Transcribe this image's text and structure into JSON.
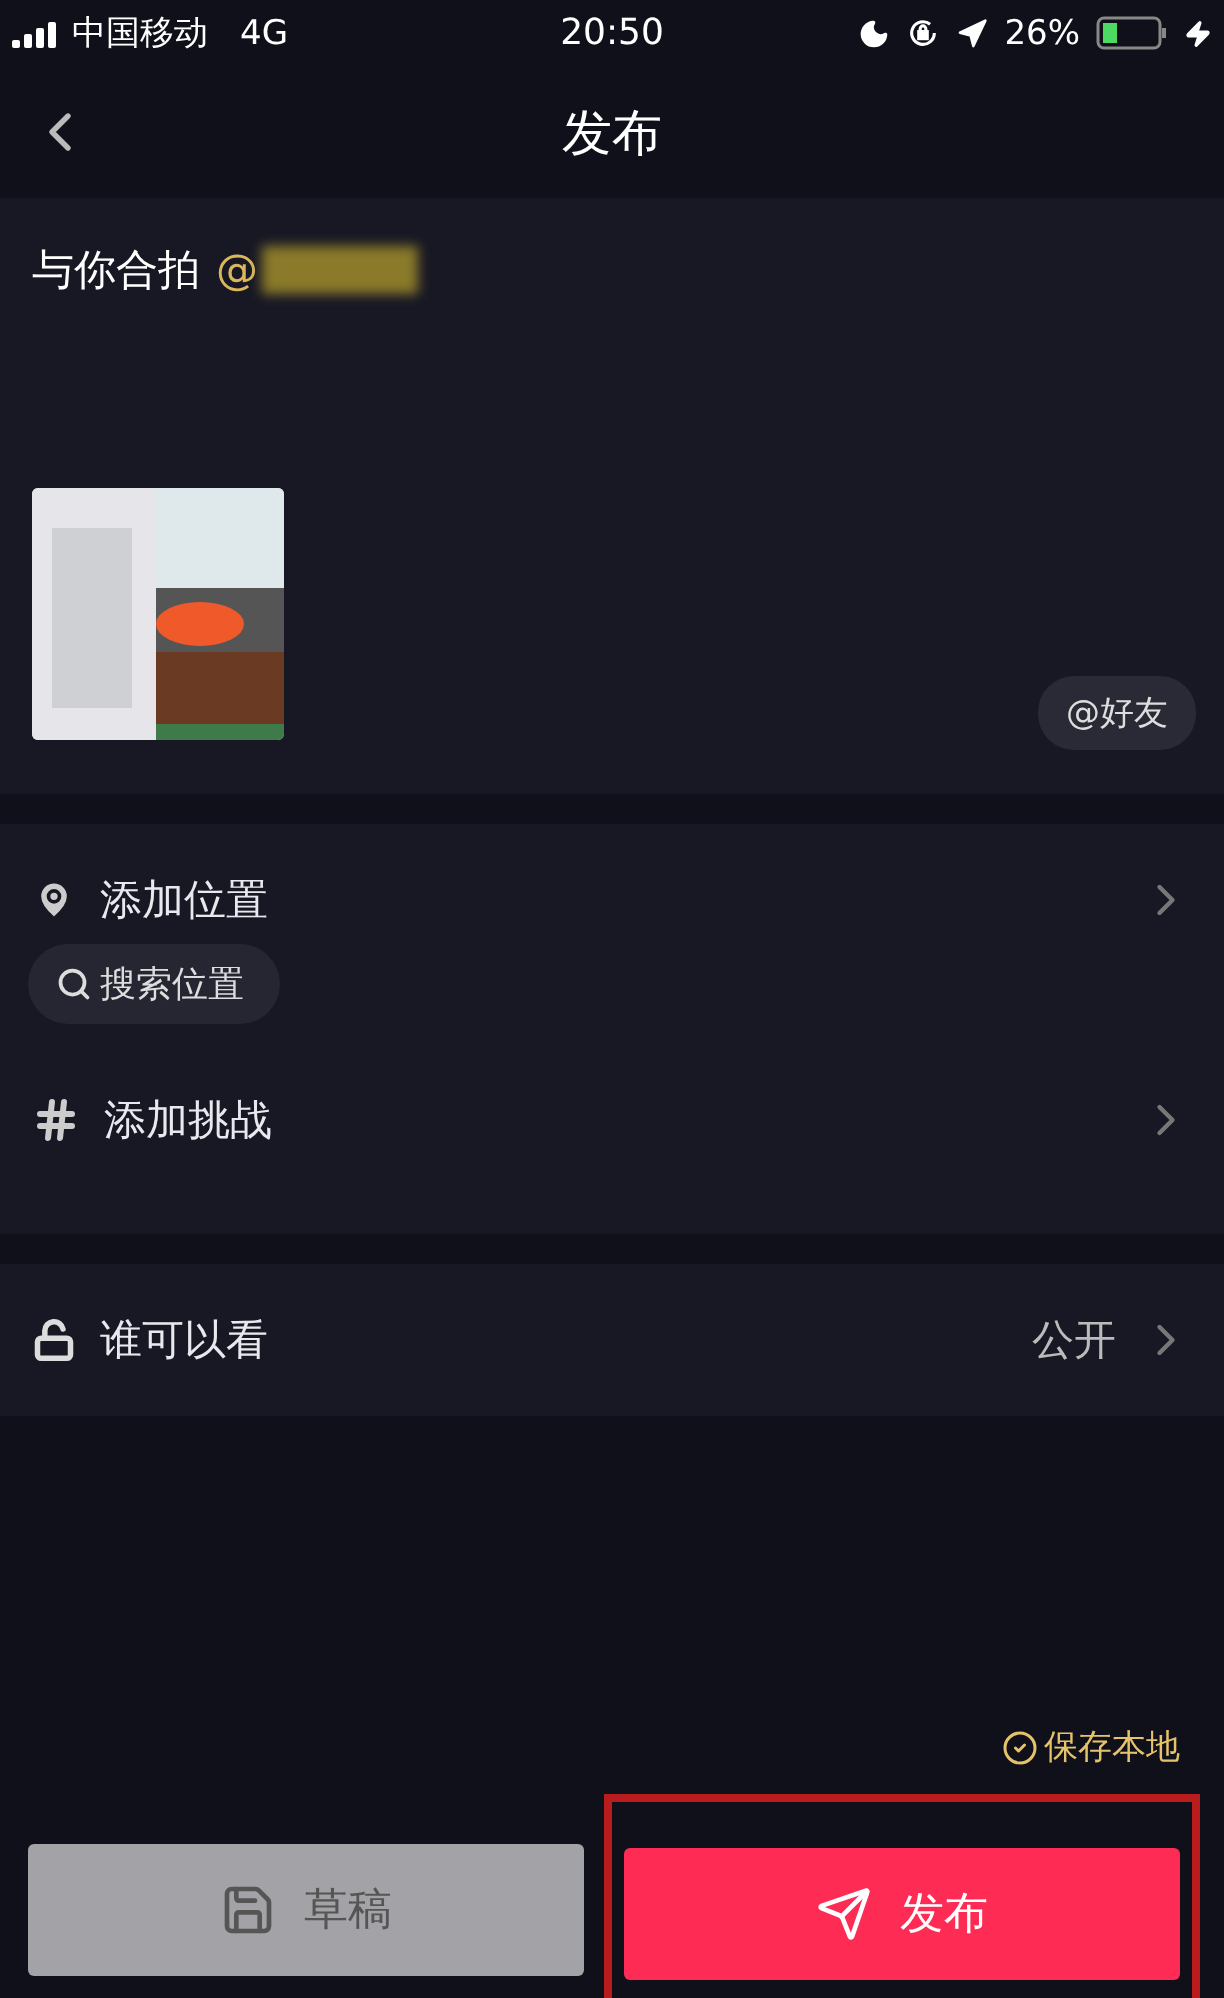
{
  "status_bar": {
    "carrier": "中国移动",
    "network": "4G",
    "time": "20:50",
    "battery": "26%"
  },
  "nav": {
    "title": "发布"
  },
  "caption": {
    "text": "与你合拍",
    "mention": "@"
  },
  "mention_friends": {
    "label": "@好友"
  },
  "location": {
    "label": "添加位置",
    "search": "搜索位置"
  },
  "challenge": {
    "label": "添加挑战"
  },
  "visibility": {
    "label": "谁可以看",
    "value": "公开"
  },
  "save_local": {
    "label": "保存本地",
    "checked": true
  },
  "buttons": [
    {
      "kind": "draft",
      "label": "草稿"
    },
    {
      "kind": "publish",
      "label": "发布",
      "highlighted": true
    }
  ]
}
